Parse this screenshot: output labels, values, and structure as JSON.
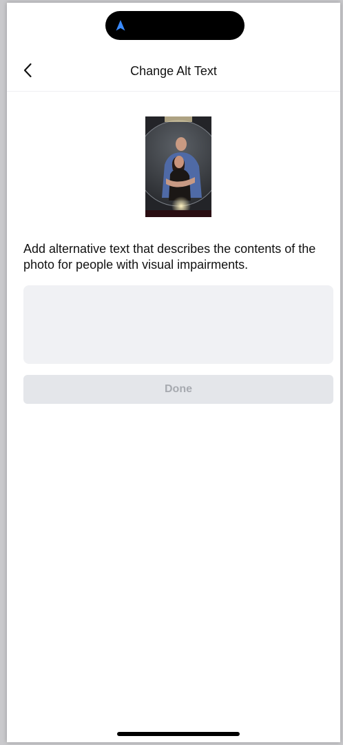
{
  "status_bar": {
    "location_icon": "navigation-arrow-icon",
    "location_icon_color": "#3a8bff"
  },
  "header": {
    "back_icon": "chevron-left-icon",
    "title": "Change Alt Text"
  },
  "photo": {
    "subject": "photo-thumbnail"
  },
  "main": {
    "description": "Add alternative text that describes the contents of the photo for people with visual impairments.",
    "alt_text_value": "",
    "alt_text_placeholder": "",
    "done_label": "Done"
  },
  "colors": {
    "input_background": "#f0f1f4",
    "button_disabled_background": "#e4e6ea",
    "button_disabled_text": "#a7aab0"
  }
}
